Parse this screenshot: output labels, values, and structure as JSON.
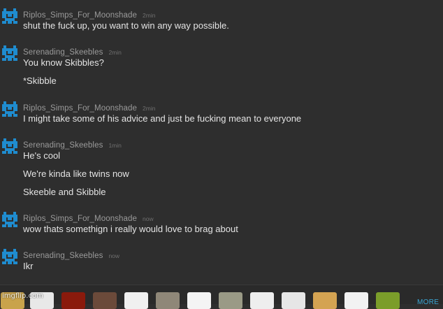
{
  "colors": {
    "background": "#2e2e2e",
    "username": "#9a9a9a",
    "timestamp": "#6f6f6f",
    "message_text": "#e4e4e4",
    "avatar_blue": "#1f8ccf",
    "more_link": "#3ba7d6"
  },
  "messages": [
    {
      "username": "Riplos_Simps_For_Moonshade",
      "time": "2min",
      "avatar": "pixel-avatar-icon",
      "lines": [
        "shut the fuck up, you want to win any way possible."
      ]
    },
    {
      "username": "Serenading_Skeebles",
      "time": "2min",
      "avatar": "pixel-avatar-icon",
      "lines": [
        "You know Skibbles?",
        "*Skibble"
      ]
    },
    {
      "username": "Riplos_Simps_For_Moonshade",
      "time": "2min",
      "avatar": "pixel-avatar-icon",
      "lines": [
        "I might take some of his advice and just be fucking mean to everyone"
      ]
    },
    {
      "username": "Serenading_Skeebles",
      "time": "1min",
      "avatar": "pixel-avatar-icon",
      "lines": [
        "He's cool",
        "We're kinda like twins now",
        "Skeeble and Skibble"
      ]
    },
    {
      "username": "Riplos_Simps_For_Moonshade",
      "time": "now",
      "avatar": "pixel-avatar-icon",
      "lines": [
        "wow thats somethign i really would love to brag about"
      ]
    },
    {
      "username": "Serenading_Skeebles",
      "time": "now",
      "avatar": "pixel-avatar-icon",
      "lines": [
        "Ikr"
      ]
    }
  ],
  "emoji_bar": {
    "more_label": "MORE",
    "items": [
      {
        "name": "emoji-meme-1-icon",
        "color": "#c9a34b"
      },
      {
        "name": "emoji-rage-face-icon",
        "color": "#e8e8e8"
      },
      {
        "name": "emoji-fire-icon",
        "color": "#8a1a0c"
      },
      {
        "name": "emoji-photo-icon",
        "color": "#6b4a3a"
      },
      {
        "name": "emoji-troll-face-icon",
        "color": "#f0f0f0"
      },
      {
        "name": "emoji-cat-icon",
        "color": "#8f8778"
      },
      {
        "name": "emoji-sketch-face-icon",
        "color": "#f4f4f4"
      },
      {
        "name": "emoji-rage-comic-icon",
        "color": "#9a9a86"
      },
      {
        "name": "emoji-me-gusta-icon",
        "color": "#eeeeee"
      },
      {
        "name": "emoji-omg-face-icon",
        "color": "#e6e6e6"
      },
      {
        "name": "emoji-doge-icon",
        "color": "#d4a352"
      },
      {
        "name": "emoji-laugh-face-icon",
        "color": "#f2f2f2"
      },
      {
        "name": "emoji-sunflower-icon",
        "color": "#7b9d2a"
      }
    ]
  },
  "watermark": "imgflip.com"
}
